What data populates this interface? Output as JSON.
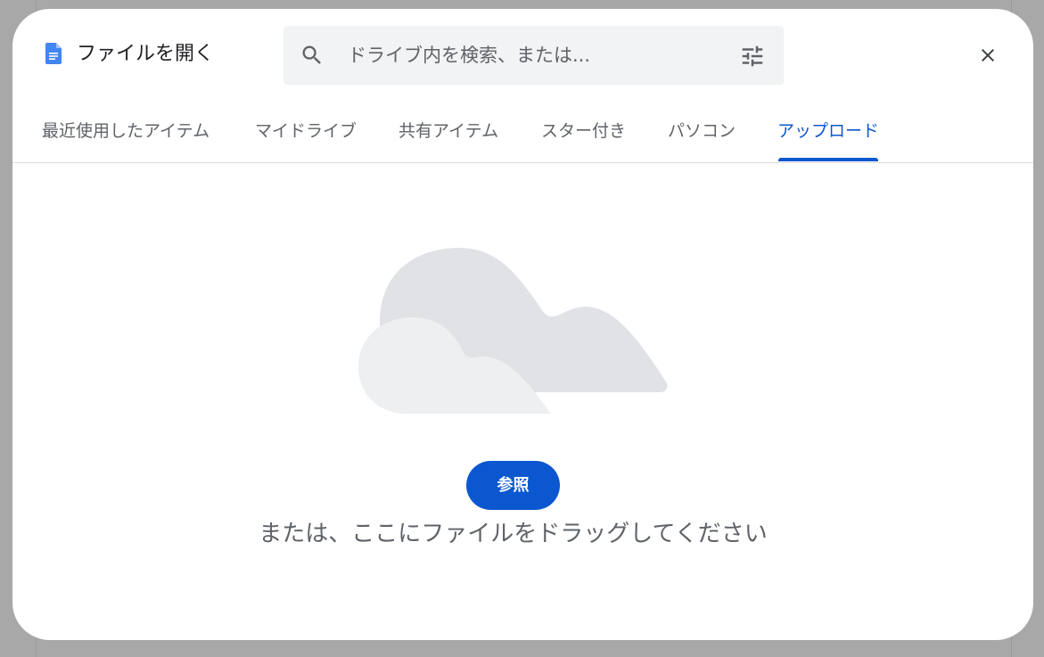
{
  "dialog": {
    "title": "ファイルを開く",
    "icon": "google-docs-icon",
    "close_icon": "close-icon"
  },
  "search": {
    "placeholder": "ドライブ内を検索、または...",
    "icon": "search-icon",
    "filter_icon": "tune-icon"
  },
  "tabs": [
    {
      "label": "最近使用したアイテム",
      "active": false
    },
    {
      "label": "マイドライブ",
      "active": false
    },
    {
      "label": "共有アイテム",
      "active": false
    },
    {
      "label": "スター付き",
      "active": false
    },
    {
      "label": "パソコン",
      "active": false
    },
    {
      "label": "アップロード",
      "active": true
    }
  ],
  "upload": {
    "browse_label": "参照",
    "drop_hint": "または、ここにファイルをドラッグしてください"
  },
  "colors": {
    "accent": "#0b57d0",
    "doc_icon": "#4285f4",
    "search_bg": "#f1f3f4",
    "cloud_back": "#e0e2e6",
    "cloud_front": "#eeeff1"
  }
}
